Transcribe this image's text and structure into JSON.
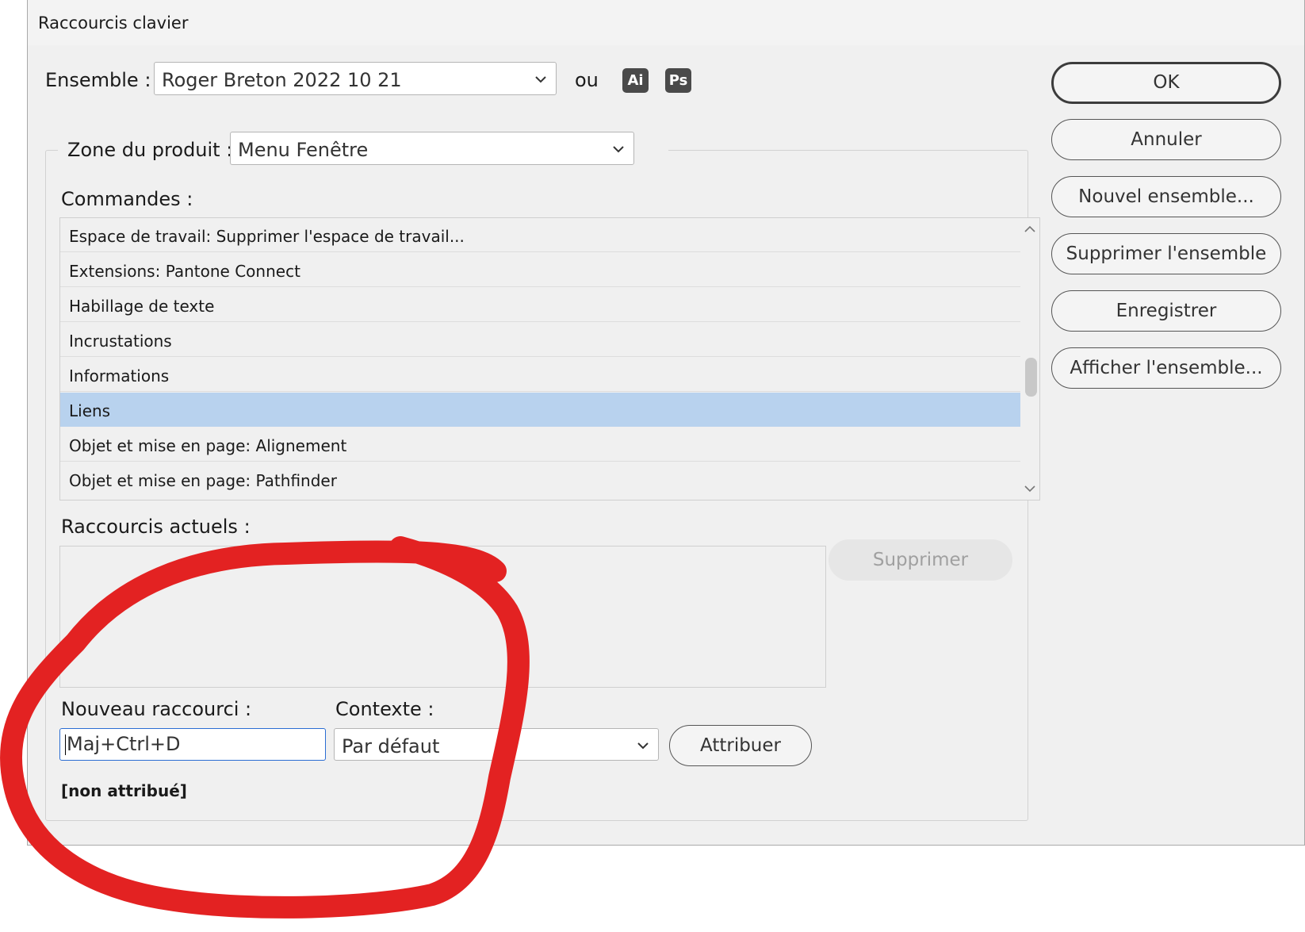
{
  "window": {
    "title": "Raccourcis clavier"
  },
  "ensemble": {
    "label": "Ensemble :",
    "value": "Roger Breton 2022 10 21",
    "or_label": "ou"
  },
  "apps": {
    "illustrator": "Ai",
    "photoshop": "Ps"
  },
  "product_zone": {
    "label": "Zone du produit :",
    "value": "Menu Fenêtre"
  },
  "commands": {
    "label": "Commandes :",
    "items": [
      "Espace de travail: Supprimer l'espace de travail...",
      "Extensions: Pantone Connect",
      "Habillage de texte",
      "Incrustations",
      "Informations",
      "Liens",
      "Objet et mise en page: Alignement",
      "Objet et mise en page: Pathfinder"
    ],
    "selected_index": 5
  },
  "current_shortcuts": {
    "label": "Raccourcis actuels :",
    "delete_label": "Supprimer"
  },
  "new_shortcut": {
    "label": "Nouveau raccourci :",
    "value": "Maj+Ctrl+D",
    "status": "[non attribué]"
  },
  "context": {
    "label": "Contexte :",
    "value": "Par défaut",
    "assign_label": "Attribuer"
  },
  "side_buttons": {
    "ok": "OK",
    "cancel": "Annuler",
    "new_set": "Nouvel ensemble...",
    "delete_set": "Supprimer l'ensemble",
    "save": "Enregistrer",
    "show_set": "Afficher l'ensemble..."
  },
  "colors": {
    "selection": "#b8d2ee",
    "annotation": "#e32222",
    "focus": "#2a6dd3"
  }
}
